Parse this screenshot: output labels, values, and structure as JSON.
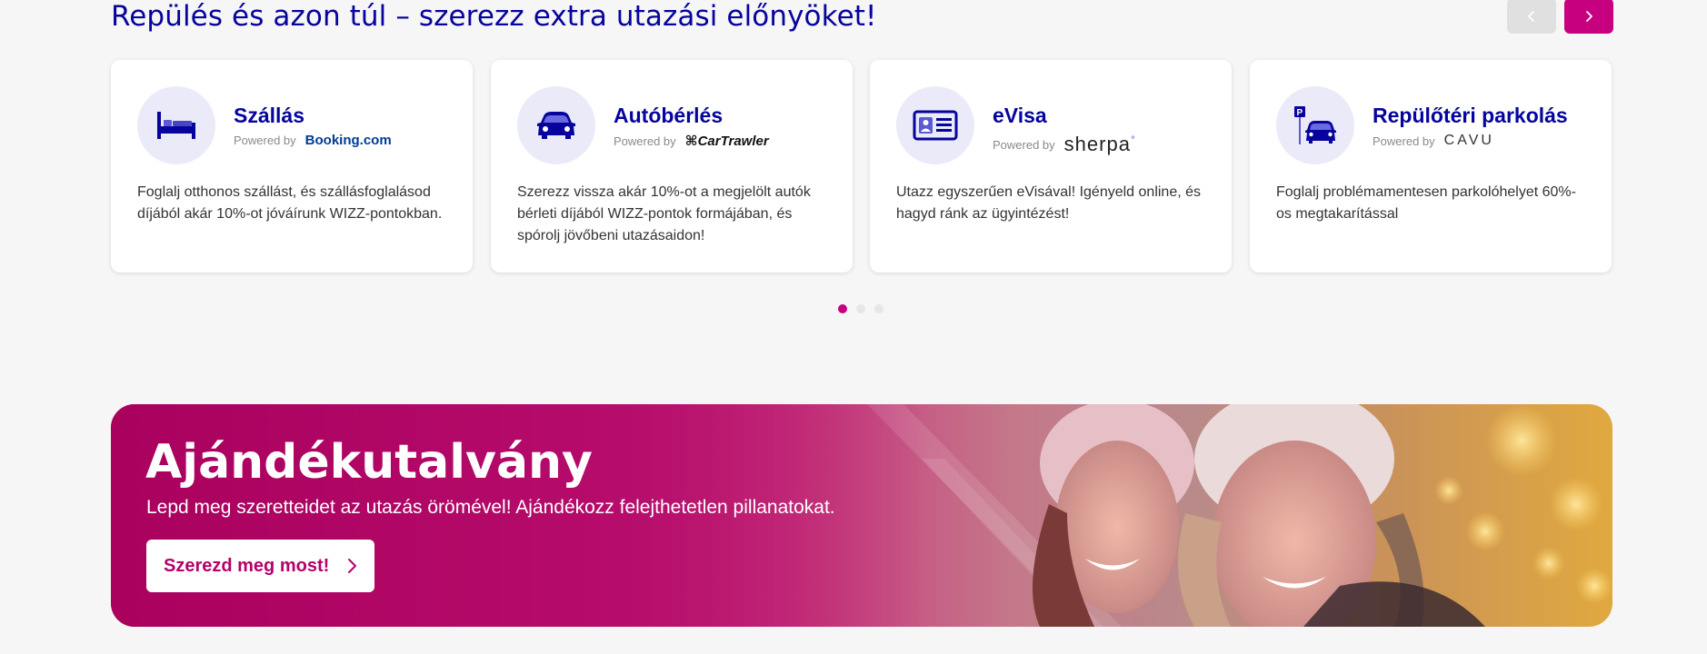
{
  "section": {
    "title": "Repülés és azon túl – szerezz extra utazási előnyöket!"
  },
  "cards": [
    {
      "title": "Szállás",
      "powered_by": "Powered by",
      "partner": "Booking.com",
      "icon": "bed-icon",
      "description": "Foglalj otthonos szállást, és szállásfoglalásod díjából akár 10%-ot jóváírunk WIZZ-pontokban."
    },
    {
      "title": "Autóbérlés",
      "powered_by": "Powered by",
      "partner": "CarTrawler",
      "icon": "car-icon",
      "description": "Szerezz vissza akár 10%-ot a megjelölt autók bérleti díjából WIZZ-pontok formájában, és spórolj jövőbeni utazásaidon!"
    },
    {
      "title": "eVisa",
      "powered_by": "Powered by",
      "partner": "sherpa",
      "partner_mark": "°",
      "icon": "id-card-icon",
      "description": "Utazz egyszerűen eVisával! Igényeld online, és hagyd ránk az ügyintézést!"
    },
    {
      "title": "Repülőtéri parkolás",
      "powered_by": "Powered by",
      "partner": "CAVU",
      "icon": "parking-car-icon",
      "description": "Foglalj problémamentesen parkolóhelyet 60%-os megtakarítással"
    }
  ],
  "carousel": {
    "pages": 3,
    "active_page": 1
  },
  "banner": {
    "title": "Ajándékutalvány",
    "subtitle": "Lepd meg szeretteidet az utazás örömével! Ajándékozz felejthetetlen pillanatokat.",
    "cta_label": "Szerezd meg most!"
  },
  "colors": {
    "brand_navy": "#06049d",
    "brand_magenta": "#c6007e",
    "background": "#f6f6f6"
  }
}
